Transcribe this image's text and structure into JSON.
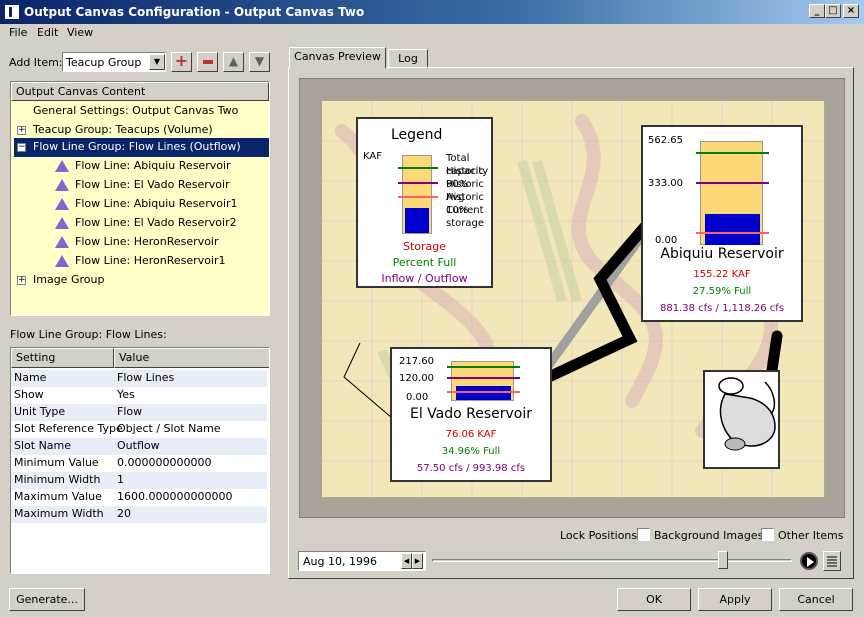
{
  "window": {
    "title": "Output Canvas Configuration - Output Canvas Two"
  },
  "menu": {
    "items": [
      "File",
      "Edit",
      "View"
    ]
  },
  "add_item": {
    "label": "Add Item:",
    "selected": "Teacup Group"
  },
  "tree": {
    "header": "Output Canvas Content",
    "items": [
      {
        "label": "General Settings: Output Canvas Two"
      },
      {
        "label": "Teacup Group: Teacups (Volume)"
      },
      {
        "label": "Flow Line Group: Flow Lines (Outflow)"
      },
      {
        "label": "Flow Line: Abiquiu Reservoir"
      },
      {
        "label": "Flow Line: El Vado Reservoir"
      },
      {
        "label": "Flow Line: Abiquiu Reservoir1"
      },
      {
        "label": "Flow Line: El Vado Reservoir2"
      },
      {
        "label": "Flow Line: HeronReservoir"
      },
      {
        "label": "Flow Line: HeronReservoir1"
      },
      {
        "label": "Image Group"
      }
    ]
  },
  "properties": {
    "title": "Flow Line Group: Flow Lines:",
    "headers": [
      "Setting",
      "Value"
    ],
    "rows": [
      [
        "Name",
        "Flow Lines"
      ],
      [
        "Show",
        "Yes"
      ],
      [
        "Unit Type",
        "Flow"
      ],
      [
        "Slot Reference Type",
        "Object / Slot Name"
      ],
      [
        "Slot Name",
        "Outflow"
      ],
      [
        "Minimum Value",
        "0.000000000000"
      ],
      [
        "Minimum Width",
        "1"
      ],
      [
        "Maximum Value",
        "1600.000000000000"
      ],
      [
        "Maximum Width",
        "20"
      ]
    ]
  },
  "tabs": [
    "Canvas Preview",
    "Log"
  ],
  "legend": {
    "title": "Legend",
    "unit": "KAF",
    "items": [
      "Total capacity",
      "Historic 90%",
      "Historic Avg",
      "Historic 10%",
      "Current storage"
    ],
    "storage": "Storage",
    "percent": "Percent Full",
    "flow": "Inflow / Outflow"
  },
  "abiquiu": {
    "ticks": [
      "562.65",
      "333.00",
      "0.00"
    ],
    "name": "Abiquiu Reservoir",
    "storage": "155.22 KAF",
    "percent": "27.59% Full",
    "flow": "881.38 cfs / 1,118.26 cfs"
  },
  "elvado": {
    "ticks": [
      "217.60",
      "120.00",
      "0.00"
    ],
    "name": "El Vado Reservoir",
    "storage": "76.06 KAF",
    "percent": "34.96% Full",
    "flow": "57.50 cfs / 993.98 cfs"
  },
  "lock": {
    "label": "Lock Positions:",
    "bg": "Background Images",
    "other": "Other Items"
  },
  "date": {
    "value": "Aug 10, 1996"
  },
  "buttons": {
    "generate": "Generate...",
    "ok": "OK",
    "apply": "Apply",
    "cancel": "Cancel"
  },
  "colors": {
    "selection": "#0a246a",
    "storage": "#0000cc",
    "percent": "#008000",
    "flow": "#800080",
    "storage_text": "#cc0000"
  }
}
